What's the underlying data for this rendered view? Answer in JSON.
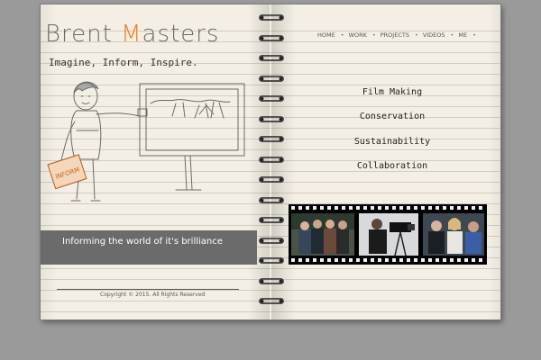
{
  "site": {
    "logo_part1": "Brent ",
    "logo_accent": "M",
    "logo_part2": "asters",
    "accent_color": "#ef7d1f",
    "tagline": "Imagine, Inform, Inspire.",
    "sketch_sign_text": "INFORM"
  },
  "nav": {
    "items": [
      {
        "label": "HOME"
      },
      {
        "label": "WORK"
      },
      {
        "label": "PROJECTS"
      },
      {
        "label": "VIDEOS"
      },
      {
        "label": "ME"
      }
    ],
    "separator": "•"
  },
  "topics": [
    "Film Making",
    "Conservation",
    "Sustainability",
    "Collaboration"
  ],
  "banner": {
    "text": "Informing the world of it's brilliance"
  },
  "footer": {
    "copyright": "Copyright © 2015. All Rights Reserved"
  },
  "filmstrip": {
    "photos": [
      "group-photo",
      "camera-operator-photo",
      "interview-photo"
    ]
  }
}
